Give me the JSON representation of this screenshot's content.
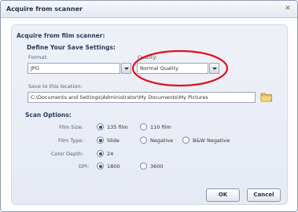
{
  "window": {
    "title": "Acquire from scanner"
  },
  "section": {
    "title": "Acquire from film scanner:"
  },
  "save_settings": {
    "title": "Define Your Save Settings:",
    "format_label": "Format:",
    "format_value": "JPG",
    "quality_label": "Quality:",
    "quality_value": "Normal Quality",
    "location_label": "Save to this location:",
    "location_value": "C:\\Documents and Settings\\Administrator\\My Documents\\My Pictures"
  },
  "scan_options": {
    "title": "Scan Options:",
    "film_size": {
      "label": "Film Size:",
      "options": [
        "135 film",
        "110 film"
      ],
      "selected": "135 film"
    },
    "film_type": {
      "label": "Film Type:",
      "options": [
        "Slide",
        "Negative",
        "B&W Negative"
      ],
      "selected": "Slide"
    },
    "color_depth": {
      "label": "Color Depth:",
      "options": [
        "24"
      ],
      "selected": "24"
    },
    "dpi": {
      "label": "DPI:",
      "options": [
        "1800",
        "3600"
      ],
      "selected": "1800"
    }
  },
  "buttons": {
    "ok": "OK",
    "cancel": "Cancel"
  },
  "colors": {
    "highlight_oval": "#e0101a",
    "folder": "#e8c25a"
  }
}
